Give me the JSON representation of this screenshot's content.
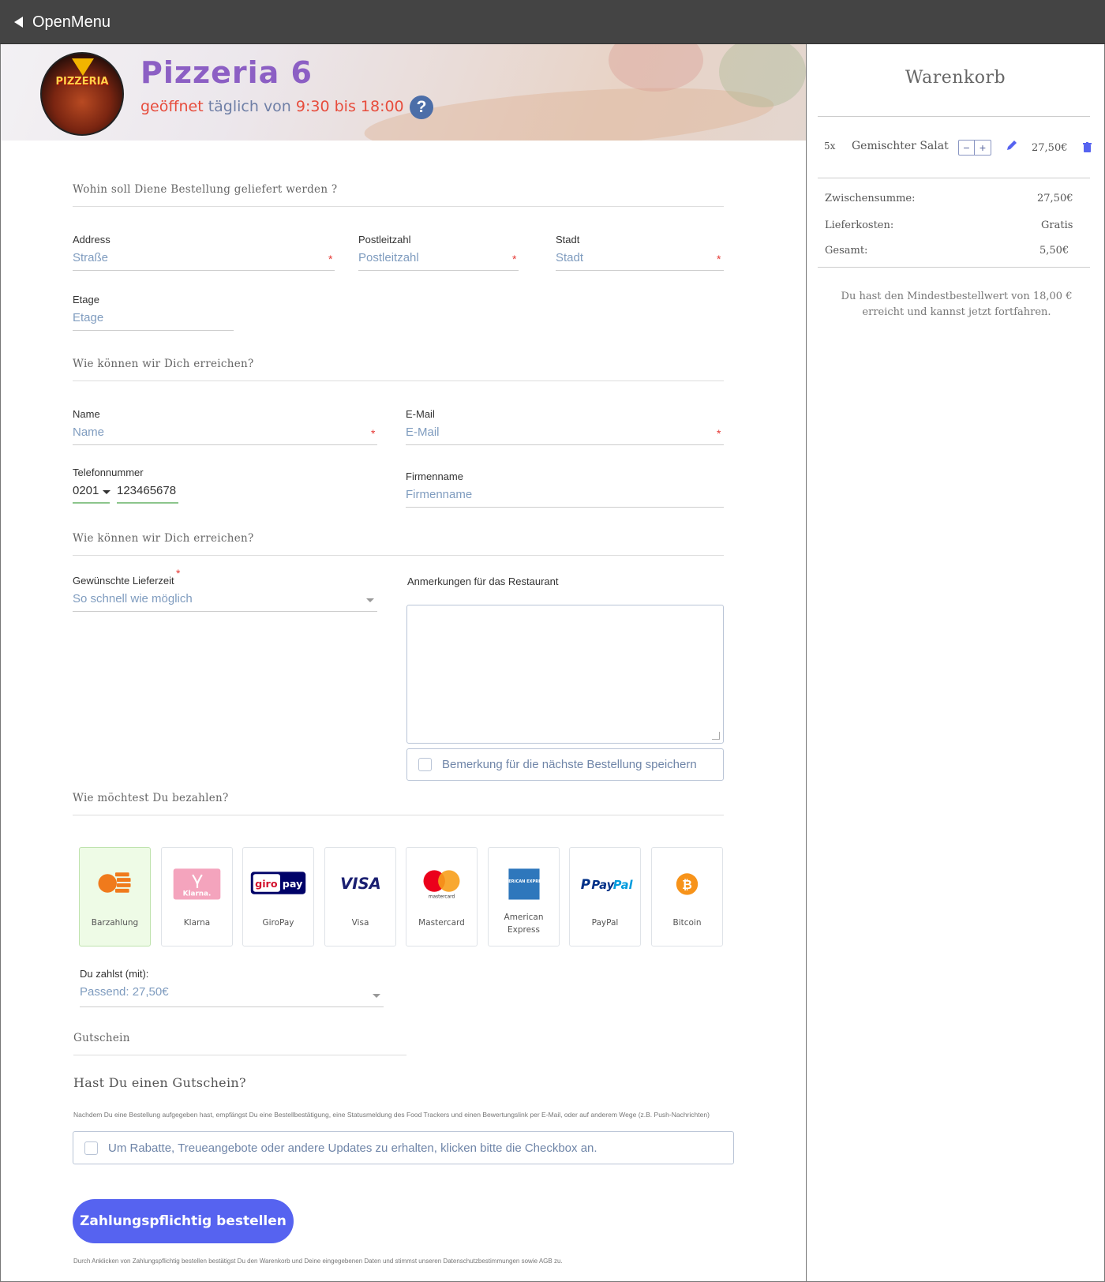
{
  "topbar": {
    "title": "OpenMenu"
  },
  "restaurant": {
    "name": "Pizzeria 6",
    "hours_prefix": "geöffnet",
    "hours_daily": "täglich von",
    "hours_range": "9:30 bis 18:00",
    "logo_text": "PIZZERIA"
  },
  "delivery": {
    "section_title": "Wohin soll Diene Bestellung geliefert werden ?",
    "address": {
      "label": "Address",
      "placeholder": "Straße"
    },
    "zip": {
      "label": "Postleitzahl",
      "placeholder": "Postleitzahl"
    },
    "city": {
      "label": "Stadt",
      "placeholder": "Stadt"
    },
    "floor": {
      "label": "Etage",
      "placeholder": "Etage"
    }
  },
  "contact": {
    "section_title": "Wie können wir Dich erreichen?",
    "name": {
      "label": "Name",
      "placeholder": "Name"
    },
    "email": {
      "label": "E-Mail",
      "placeholder": "E-Mail"
    },
    "phone": {
      "label": "Telefonnummer",
      "prefix": "0201",
      "number": "123465678"
    },
    "company": {
      "label": "Firmenname",
      "placeholder": "Firmenname"
    }
  },
  "timing": {
    "section_title": "Wie können wir Dich erreichen?",
    "delivery_time": {
      "label": "Gewünschte Lieferzeit",
      "value": "So schnell wie möglich"
    },
    "notes": {
      "label": "Anmerkungen für das Restaurant"
    },
    "save_note_label": "Bemerkung für die nächste Bestellung speichern"
  },
  "payment": {
    "section_title": "Wie möchtest Du bezahlen?",
    "methods": [
      {
        "label": "Barzahlung",
        "icon": "cash-icon",
        "selected": true
      },
      {
        "label": "Klarna",
        "icon": "klarna-icon",
        "logo": "Klarna."
      },
      {
        "label": "GiroPay",
        "icon": "giropay-icon",
        "logo_a": "giro",
        "logo_b": "pay"
      },
      {
        "label": "Visa",
        "icon": "visa-icon",
        "logo": "VISA"
      },
      {
        "label": "Mastercard",
        "icon": "mastercard-icon",
        "logo": "mastercard"
      },
      {
        "label": "American Express",
        "icon": "amex-icon",
        "logo": "AMERICAN EXPRESS"
      },
      {
        "label": "PayPal",
        "icon": "paypal-icon",
        "logo_a": "Pay",
        "logo_b": "Pal"
      },
      {
        "label": "Bitcoin",
        "icon": "bitcoin-icon",
        "logo": "₿"
      }
    ],
    "pay_with": {
      "label": "Du zahlst (mit):",
      "value": "Passend: 27,50€"
    }
  },
  "voucher": {
    "section_title": "Gutschein",
    "question": "Hast Du einen Gutschein?"
  },
  "legal": {
    "info": "Nachdem Du eine Bestellung aufgegeben hast, empfängst Du eine Bestellbestätigung, eine Statusmeldung des Food Trackers und einen Bewertungslink per E-Mail, oder auf anderem Wege (z.B. Push-Nachrichten)",
    "newsletter_label": "Um Rabatte, Treueangebote oder andere Updates zu erhalten, klicken bitte die Checkbox an.",
    "order_button": "Zahlungspflichtig bestellen",
    "disclaimer": "Durch Anklicken von Zahlungspflichtig bestellen bestätigst Du den Warenkorb und Deine eingegebenen Daten und stimmst unseren Datenschutzbestimmungen sowie AGB zu."
  },
  "cart": {
    "title": "Warenkorb",
    "items": [
      {
        "qty": "5x",
        "name": "Gemischter Salat",
        "price": "27,50€"
      }
    ],
    "subtotal_label": "Zwischensumme:",
    "subtotal": "27,50€",
    "delivery_label": "Lieferkosten:",
    "delivery": "Gratis",
    "total_label": "Gesamt:",
    "total": "5,50€",
    "note": "Du hast den Mindestbestellwert von 18,00 € erreicht und kannst jetzt fortfahren."
  },
  "colors": {
    "accent": "#5663f0",
    "brand": "#8c5fc4",
    "hours": "#e74c3c",
    "required": "#e53935",
    "selected_payment": "#eefbe6"
  }
}
